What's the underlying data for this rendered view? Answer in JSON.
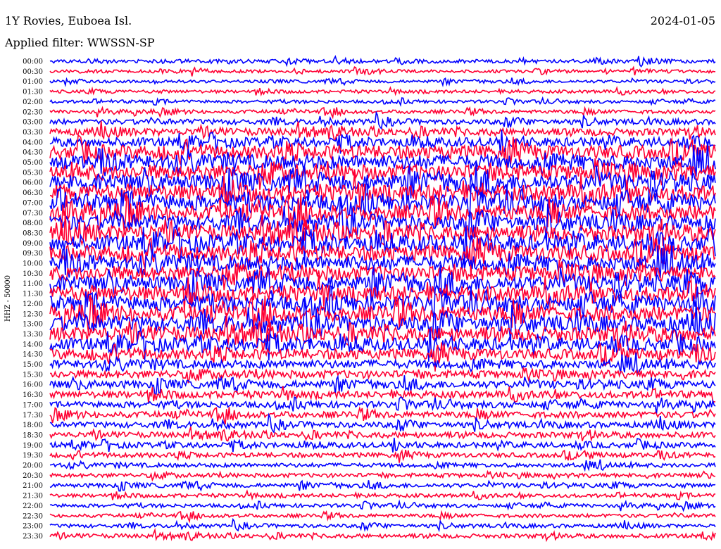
{
  "header": {
    "station": "1Y Rovies, Euboea Isl.",
    "date": "2024-01-05",
    "filter": "Applied filter: WWSSN-SP"
  },
  "chart_data": {
    "type": "line",
    "title": "1Y Rovies, Euboea Isl.",
    "subtitle": "Applied filter: WWSSN-SP",
    "date": "2024-01-05",
    "ylabel": "HHZ - 50000",
    "colors": [
      "#0000ff",
      "#ff0033"
    ],
    "grid": false,
    "tick_labels": [
      "00:00",
      "00:30",
      "01:00",
      "01:30",
      "02:00",
      "02:30",
      "03:00",
      "03:30",
      "04:00",
      "04:30",
      "05:00",
      "05:30",
      "06:00",
      "06:30",
      "07:00",
      "07:30",
      "08:00",
      "08:30",
      "09:00",
      "09:30",
      "10:00",
      "10:30",
      "11:00",
      "11:30",
      "12:00",
      "12:30",
      "13:00",
      "13:30",
      "14:00",
      "14:30",
      "15:00",
      "15:30",
      "16:00",
      "16:30",
      "17:00",
      "17:30",
      "18:00",
      "18:30",
      "19:00",
      "19:30",
      "20:00",
      "20:30",
      "21:00",
      "21:30",
      "22:00",
      "22:30",
      "23:00",
      "23:30"
    ],
    "amplitude_profile": [
      0.35,
      0.3,
      0.28,
      0.3,
      0.3,
      0.35,
      0.5,
      0.7,
      0.85,
      1.3,
      1.4,
      1.5,
      1.55,
      1.55,
      1.55,
      1.5,
      1.45,
      1.5,
      1.5,
      1.5,
      1.45,
      1.45,
      1.45,
      1.45,
      1.45,
      1.45,
      1.45,
      1.4,
      1.2,
      1.0,
      0.8,
      0.75,
      0.7,
      0.65,
      0.6,
      0.6,
      0.55,
      0.55,
      0.5,
      0.45,
      0.4,
      0.4,
      0.4,
      0.35,
      0.35,
      0.35,
      0.35,
      0.4
    ]
  }
}
